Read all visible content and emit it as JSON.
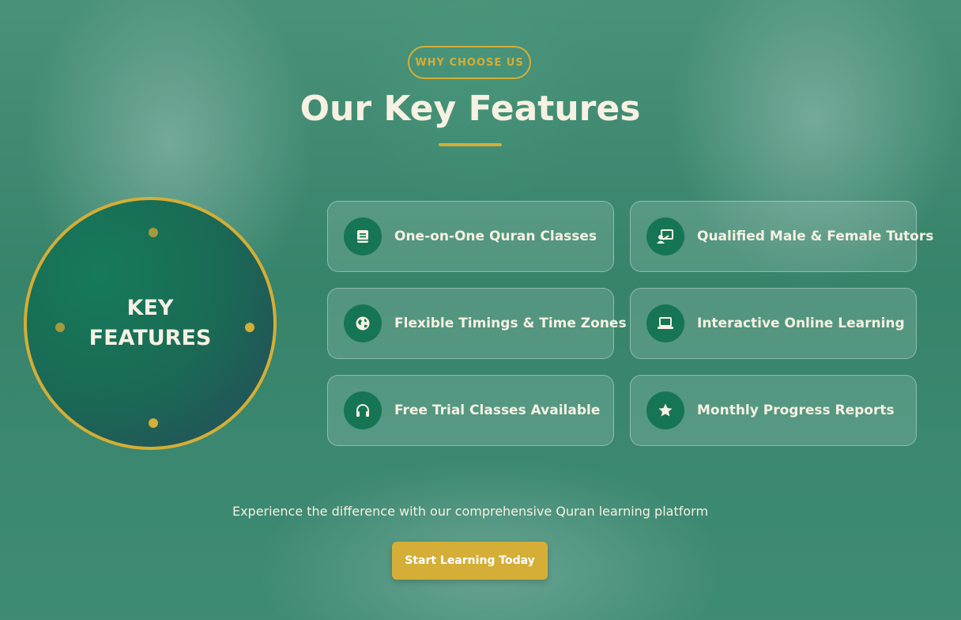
{
  "section": {
    "badge": "WHY CHOOSE US",
    "title": "Our Key Features",
    "circle_lines": [
      "KEY",
      "FEATURES"
    ],
    "features": [
      {
        "label": "One-on-One Quran Classes",
        "icon": "book-icon"
      },
      {
        "label": "Qualified Male & Female Tutors",
        "icon": "teacher-icon"
      },
      {
        "label": "Flexible Timings & Time Zones",
        "icon": "globe-icon"
      },
      {
        "label": "Interactive Online Learning",
        "icon": "laptop-icon"
      },
      {
        "label": "Free Trial Classes Available",
        "icon": "headphones-icon"
      },
      {
        "label": "Monthly Progress Reports",
        "icon": "star-icon"
      }
    ],
    "tagline": "Experience the difference with our comprehensive Quran learning platform",
    "cta_label": "Start Learning Today"
  },
  "colors": {
    "accent_gold": "#d4ae36",
    "icon_green": "#157554",
    "text_cream": "#f6f1e2"
  }
}
